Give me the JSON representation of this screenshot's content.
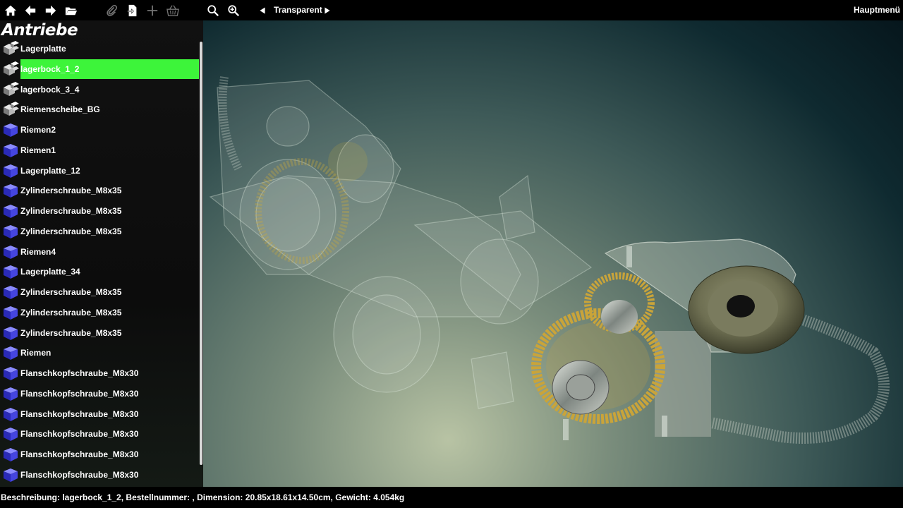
{
  "toolbar": {
    "mode_label": "Transparent",
    "main_menu": "Hauptmenü",
    "icons": [
      "home-icon",
      "back-arrow-icon",
      "forward-arrow-icon",
      "folder-icon",
      "paperclip-icon",
      "document-export-icon",
      "plus-icon",
      "basket-icon",
      "search-icon",
      "zoom-in-icon",
      "prev-triangle-icon",
      "next-triangle-icon"
    ]
  },
  "tree": {
    "title": "Antriebe",
    "items": [
      {
        "label": "Lagerplatte",
        "icon": "assembly"
      },
      {
        "label": "lagerbock_1_2",
        "icon": "assembly",
        "selected": true
      },
      {
        "label": "lagerbock_3_4",
        "icon": "assembly"
      },
      {
        "label": "Riemenscheibe_BG",
        "icon": "assembly"
      },
      {
        "label": "Riemen2",
        "icon": "part"
      },
      {
        "label": "Riemen1",
        "icon": "part"
      },
      {
        "label": "Lagerplatte_12",
        "icon": "part"
      },
      {
        "label": "Zylinderschraube_M8x35",
        "icon": "part"
      },
      {
        "label": "Zylinderschraube_M8x35",
        "icon": "part"
      },
      {
        "label": "Zylinderschraube_M8x35",
        "icon": "part"
      },
      {
        "label": "Riemen4",
        "icon": "part"
      },
      {
        "label": "Lagerplatte_34",
        "icon": "part"
      },
      {
        "label": "Zylinderschraube_M8x35",
        "icon": "part"
      },
      {
        "label": "Zylinderschraube_M8x35",
        "icon": "part"
      },
      {
        "label": "Zylinderschraube_M8x35",
        "icon": "part"
      },
      {
        "label": "Riemen",
        "icon": "part"
      },
      {
        "label": "Flanschkopfschraube_M8x30",
        "icon": "part"
      },
      {
        "label": "Flanschkopfschraube_M8x30",
        "icon": "part"
      },
      {
        "label": "Flanschkopfschraube_M8x30",
        "icon": "part"
      },
      {
        "label": "Flanschkopfschraube_M8x30",
        "icon": "part"
      },
      {
        "label": "Flanschkopfschraube_M8x30",
        "icon": "part"
      },
      {
        "label": "Flanschkopfschraube_M8x30",
        "icon": "part"
      }
    ]
  },
  "status": {
    "text": "Beschreibung: lagerbock_1_2, Bestellnummer: , Dimension: 20.85x18.61x14.50cm, Gewicht: 4.054kg"
  },
  "colors": {
    "selection": "#3df43a",
    "part_icon": "#3a3ad8",
    "gear": "#c9a43a"
  }
}
